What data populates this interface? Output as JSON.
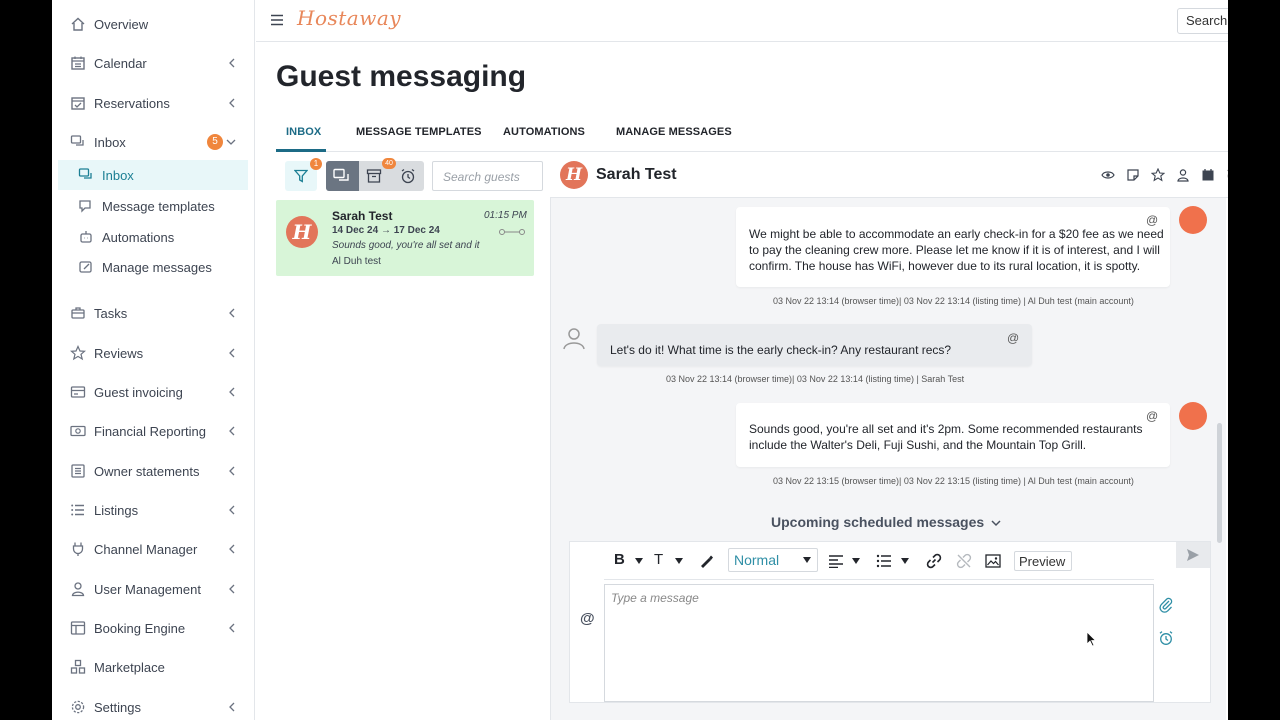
{
  "sidebar": {
    "items": [
      {
        "label": "Overview",
        "icon": "home-icon"
      },
      {
        "label": "Calendar",
        "icon": "calendar-icon"
      },
      {
        "label": "Reservations",
        "icon": "reservations-icon"
      },
      {
        "label": "Inbox",
        "icon": "chat-icon",
        "badge": "5"
      },
      {
        "label": "Inbox",
        "icon": "chat-icon"
      },
      {
        "label": "Message templates",
        "icon": "template-icon"
      },
      {
        "label": "Automations",
        "icon": "robot-icon"
      },
      {
        "label": "Manage messages",
        "icon": "edit-icon"
      },
      {
        "label": "Tasks",
        "icon": "tasks-icon"
      },
      {
        "label": "Reviews",
        "icon": "star-icon"
      },
      {
        "label": "Guest invoicing",
        "icon": "invoice-icon"
      },
      {
        "label": "Financial Reporting",
        "icon": "money-icon"
      },
      {
        "label": "Owner statements",
        "icon": "statement-icon"
      },
      {
        "label": "Listings",
        "icon": "list-icon"
      },
      {
        "label": "Channel Manager",
        "icon": "plug-icon"
      },
      {
        "label": "User Management",
        "icon": "user-icon"
      },
      {
        "label": "Booking Engine",
        "icon": "booking-icon"
      },
      {
        "label": "Marketplace",
        "icon": "marketplace-icon"
      },
      {
        "label": "Settings",
        "icon": "gear-icon"
      }
    ]
  },
  "topbar": {
    "logo": "Hostaway",
    "search": "Search"
  },
  "page": {
    "title": "Guest messaging"
  },
  "tabs": [
    "INBOX",
    "MESSAGE TEMPLATES",
    "AUTOMATIONS",
    "MANAGE MESSAGES"
  ],
  "list": {
    "filter_badge": "1",
    "archive_badge": "40",
    "search_placeholder": "Search guests",
    "conversation": {
      "name": "Sarah Test",
      "time": "01:15 PM",
      "check_in": "14 Dec 24",
      "arrow": "→",
      "check_out": "17 Dec 24",
      "preview": "Sounds good, you're all set and it",
      "account": "Al Duh test"
    }
  },
  "chat": {
    "guest_name": "Sarah Test",
    "messages": [
      {
        "dir": "out",
        "lines": [
          "We might be able to accommodate an early check-in for a $20 fee as we need",
          "to pay the cleaning crew more. Please let me know if it is of interest, and I will",
          "confirm. The house has WiFi, however due to its rural location, it is spotty."
        ],
        "meta": "03 Nov 22 13:14 (browser time)| 03 Nov 22 13:14 (listing time) | Al Duh test (main account)"
      },
      {
        "dir": "in",
        "lines": [
          "Let's do it! What time is the early check-in? Any restaurant recs?"
        ],
        "meta": "03 Nov 22 13:14 (browser time)| 03 Nov 22 13:14 (listing time) | Sarah Test"
      },
      {
        "dir": "out",
        "lines": [
          "Sounds good, you're all set and it's 2pm. Some recommended restaurants",
          "include the Walter's Deli, Fuji Sushi, and the Mountain Top Grill."
        ],
        "meta": "03 Nov 22 13:15 (browser time)| 03 Nov 22 13:15 (listing time) | Al Duh test (main account)"
      }
    ],
    "mention_symbol": "@",
    "upcoming": "Upcoming scheduled messages",
    "composer": {
      "bold": "B",
      "text_size": "T",
      "style": "Normal",
      "preview": "Preview",
      "placeholder": "Type a message"
    }
  },
  "colors": {
    "accent": "#1c6b86",
    "brand": "#e8875a",
    "badge": "#f0863d",
    "selected_conversation": "#d8f5d8"
  }
}
